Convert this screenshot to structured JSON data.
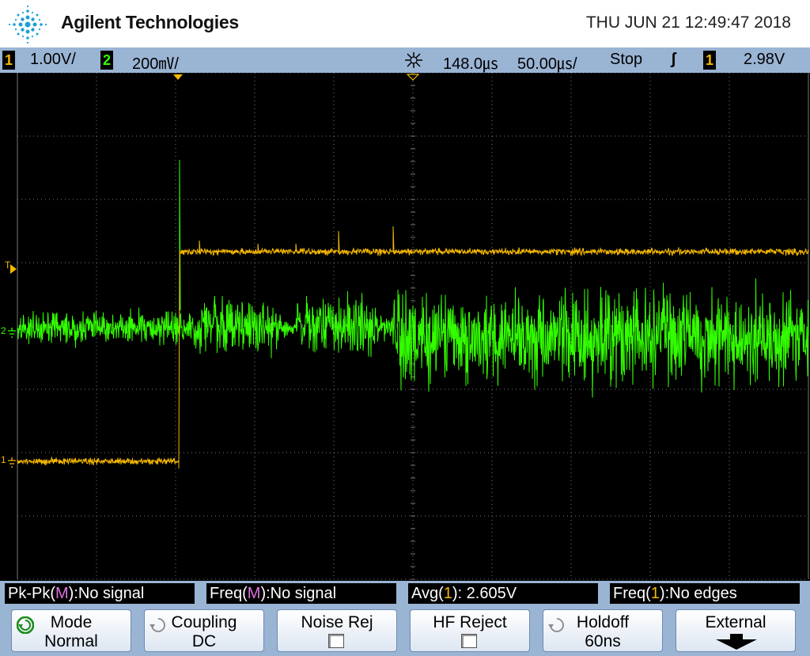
{
  "header": {
    "brand": "Agilent Technologies",
    "datetime": "THU JUN 21 12:49:47 2018"
  },
  "status": {
    "ch1_num": "1",
    "ch1_scale": "1.00V/",
    "ch2_num": "2",
    "ch2_scale": "200㎷/",
    "delay": "148.0㎲",
    "timebase": "50.00㎲/",
    "run_state": "Stop",
    "trigger_slope": "ʃ",
    "trig_ch_num": "1",
    "trig_level": "2.98V"
  },
  "markers": {
    "trigger_level": "T",
    "ch2_ground": "2",
    "ch1_ground": "1"
  },
  "measurements": [
    {
      "prefix": "Pk-Pk(",
      "src": "M",
      "suffix": "):No signal"
    },
    {
      "prefix": "Freq(",
      "src": "M",
      "suffix": "):No signal"
    },
    {
      "prefix": "Avg(",
      "src": "1",
      "suffix": "): 2.605V"
    },
    {
      "prefix": "Freq(",
      "src": "1",
      "suffix": "):No edges"
    }
  ],
  "softkeys": [
    {
      "line1": "Mode",
      "line2": "Normal"
    },
    {
      "line1": "Coupling",
      "line2": "DC"
    },
    {
      "line1": "Noise Rej",
      "line2": ""
    },
    {
      "line1": "HF Reject",
      "line2": ""
    },
    {
      "line1": "Holdoff",
      "line2": "60ns"
    },
    {
      "line1": "External",
      "line2": ""
    }
  ],
  "colors": {
    "ch1": "#f5b800",
    "ch2": "#33ff00",
    "grid": "#777777",
    "bar": "#9ab4d4",
    "math": "#e070e0"
  },
  "icons": {
    "brand_logo": "spark-logo-icon",
    "acquire": "acquire-icon",
    "rotary": "rotary-knob-icon",
    "down_arrow": "down-arrow-icon"
  }
}
